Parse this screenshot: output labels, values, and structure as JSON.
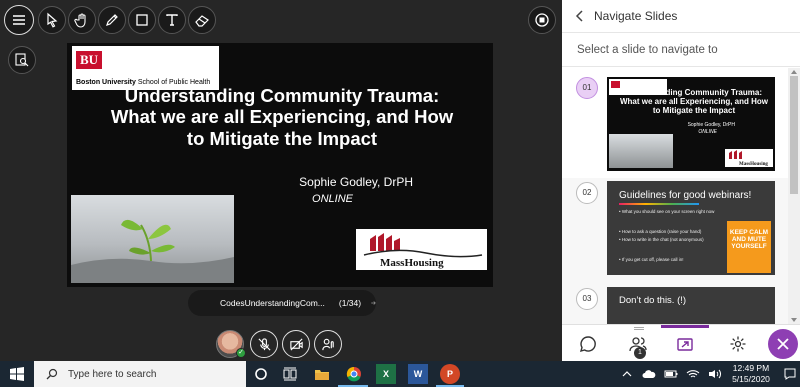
{
  "stage": {
    "tools": [
      "menu-icon",
      "pointer-icon",
      "hand-icon",
      "pen-icon",
      "rectangle-icon",
      "text-icon",
      "eraser-icon"
    ],
    "slide": {
      "bu_logo_abbr": "BU",
      "bu_logo_name": "Boston University",
      "bu_logo_school": "School of Public Health",
      "title": "Understanding Community Trauma: What we are all Experiencing, and How to Mitigate the Impact",
      "author": "Sophie Godley, DrPH",
      "mode": "ONLINE",
      "masshousing_logo": "MassHousing"
    },
    "slide_nav": {
      "file_name": "CodesUnderstandingCom...",
      "position": "(1/34)"
    }
  },
  "panel": {
    "title": "Navigate Slides",
    "subtitle": "Select a slide to navigate to",
    "slides": [
      {
        "number": "01",
        "selected": true,
        "title": "Understanding Community Trauma: What we are all Experiencing, and How to Mitigate the Impact",
        "author": "Sophie Godley, DrPH",
        "mode": "ONLINE",
        "logo": "MassHousing"
      },
      {
        "number": "02",
        "selected": false,
        "title": "Guidelines for good webinars!",
        "lines": [
          "• What you should see on your screen right now",
          "• How to ask a question (raise your hand)",
          "• How to write in the chat (not anonymous)",
          "• If you get cut off, please call in!"
        ],
        "poster": "KEEP CALM AND MUTE YOURSELF"
      },
      {
        "number": "03",
        "selected": false,
        "title": "Don’t do this. (!)"
      }
    ],
    "footer": {
      "attendee_count": "1"
    }
  },
  "taskbar": {
    "search_placeholder": "Type here to search",
    "time": "12:49 PM",
    "date": "5/15/2020",
    "apps": [
      "cortana",
      "task-view",
      "file-explorer",
      "chrome",
      "excel",
      "word",
      "powerpoint"
    ]
  }
}
